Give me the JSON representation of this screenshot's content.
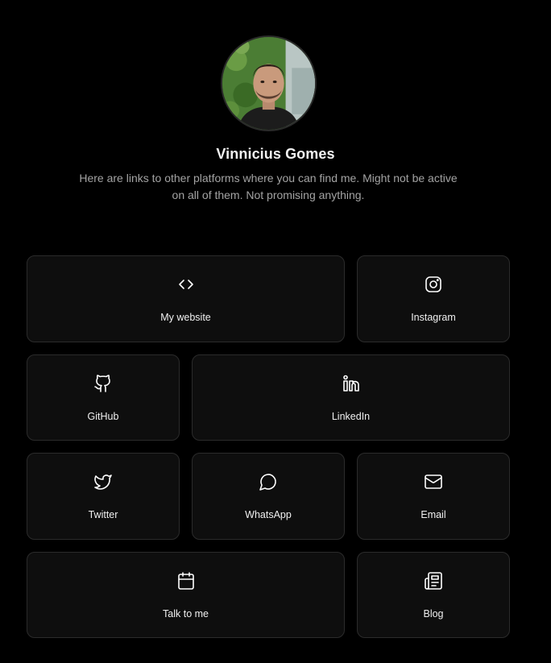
{
  "profile": {
    "name": "Vinnicius Gomes",
    "bio_line1": "Here are links to other platforms where you can find me. Might not be active",
    "bio_line2": "on all of them. Not promising anything."
  },
  "links": {
    "website": {
      "label": "My website",
      "icon": "code-icon"
    },
    "instagram": {
      "label": "Instagram",
      "icon": "instagram-icon"
    },
    "github": {
      "label": "GitHub",
      "icon": "github-icon"
    },
    "linkedin": {
      "label": "LinkedIn",
      "icon": "linkedin-icon"
    },
    "twitter": {
      "label": "Twitter",
      "icon": "twitter-icon"
    },
    "whatsapp": {
      "label": "WhatsApp",
      "icon": "message-circle-icon"
    },
    "email": {
      "label": "Email",
      "icon": "mail-icon"
    },
    "talk": {
      "label": "Talk to me",
      "icon": "calendar-icon"
    },
    "blog": {
      "label": "Blog",
      "icon": "newspaper-icon"
    }
  },
  "colors": {
    "background": "#000000",
    "card": "#0e0e0e",
    "card_border": "#2b2b2b",
    "text": "#ffffff",
    "muted": "#a3a3a3"
  }
}
